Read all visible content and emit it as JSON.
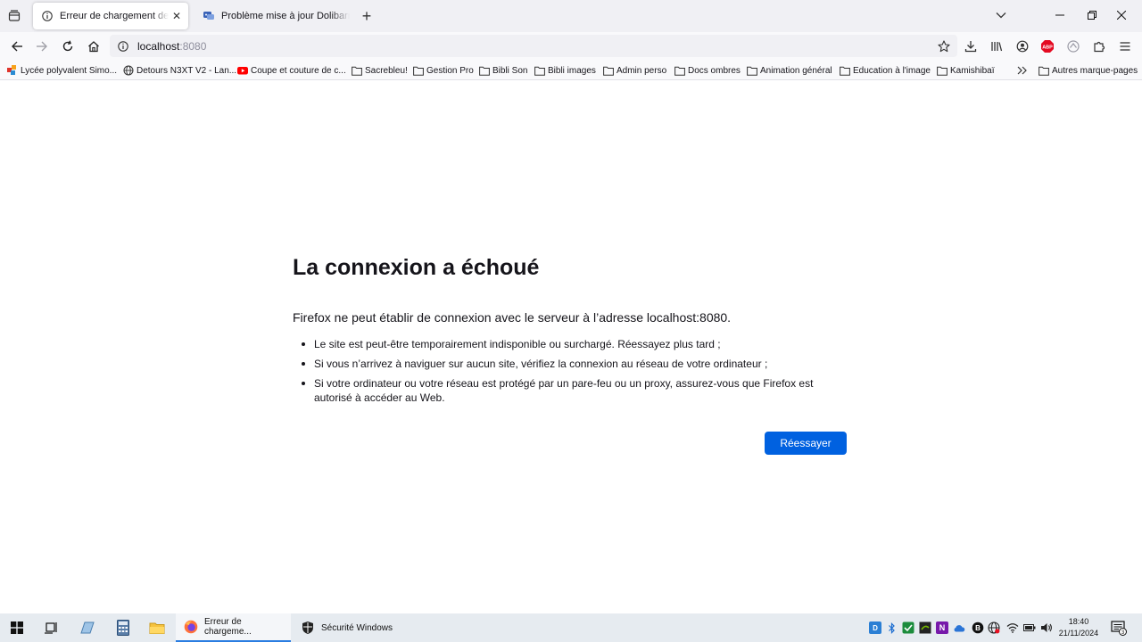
{
  "browser": {
    "tabs": [
      {
        "title": "Erreur de chargement de la page",
        "icon": "info-icon",
        "active": true
      },
      {
        "title": "Problème mise à jour Dolibarr \\",
        "icon": "forum-favicon-icon",
        "active": false
      }
    ],
    "new_tab_label": "+",
    "url": {
      "host": "localhost",
      "port": ":8080"
    },
    "bookmarks": [
      {
        "label": "Lycée polyvalent Simo...",
        "icon": "site-favicon-icon"
      },
      {
        "label": "Detours N3XT V2 - Lan...",
        "icon": "globe-icon"
      },
      {
        "label": "Coupe et couture de c...",
        "icon": "youtube-icon"
      },
      {
        "label": "Sacrebleu!",
        "icon": "folder-icon"
      },
      {
        "label": "Gestion Pro",
        "icon": "folder-icon"
      },
      {
        "label": "Bibli Son",
        "icon": "folder-icon"
      },
      {
        "label": "Bibli images",
        "icon": "folder-icon"
      },
      {
        "label": "Admin perso",
        "icon": "folder-icon"
      },
      {
        "label": "Docs ombres",
        "icon": "folder-icon"
      },
      {
        "label": "Animation général",
        "icon": "folder-icon"
      },
      {
        "label": "Education à l'image",
        "icon": "folder-icon"
      },
      {
        "label": "Kamishibaï",
        "icon": "folder-icon"
      }
    ],
    "other_bookmarks": "Autres marque-pages",
    "adblock_label": "ABP"
  },
  "error_page": {
    "title": "La connexion a échoué",
    "description": "Firefox ne peut établir de connexion avec le serveur à l’adresse localhost:8080.",
    "bullets": [
      "Le site est peut-être temporairement indisponible ou surchargé. Réessayez plus tard ;",
      "Si vous n’arrivez à naviguer sur aucun site, vérifiez la connexion au réseau de votre ordinateur ;",
      "Si votre ordinateur ou votre réseau est protégé par un pare-feu ou un proxy, assurez-vous que Firefox est autorisé à accéder au Web."
    ],
    "retry_label": "Réessayer"
  },
  "taskbar": {
    "apps": [
      {
        "label": "Erreur de chargeme...",
        "icon": "firefox-icon",
        "active": true
      },
      {
        "label": "Sécurité Windows",
        "icon": "shield-icon",
        "active": false
      }
    ],
    "clock": {
      "time": "18:40",
      "date": "21/11/2024"
    },
    "notification_count": "3"
  },
  "colors": {
    "accent": "#0061e0",
    "tab_strip": "#f0f0f4",
    "toolbar": "#f9f9fb",
    "taskbar": "#e6ebf0"
  }
}
